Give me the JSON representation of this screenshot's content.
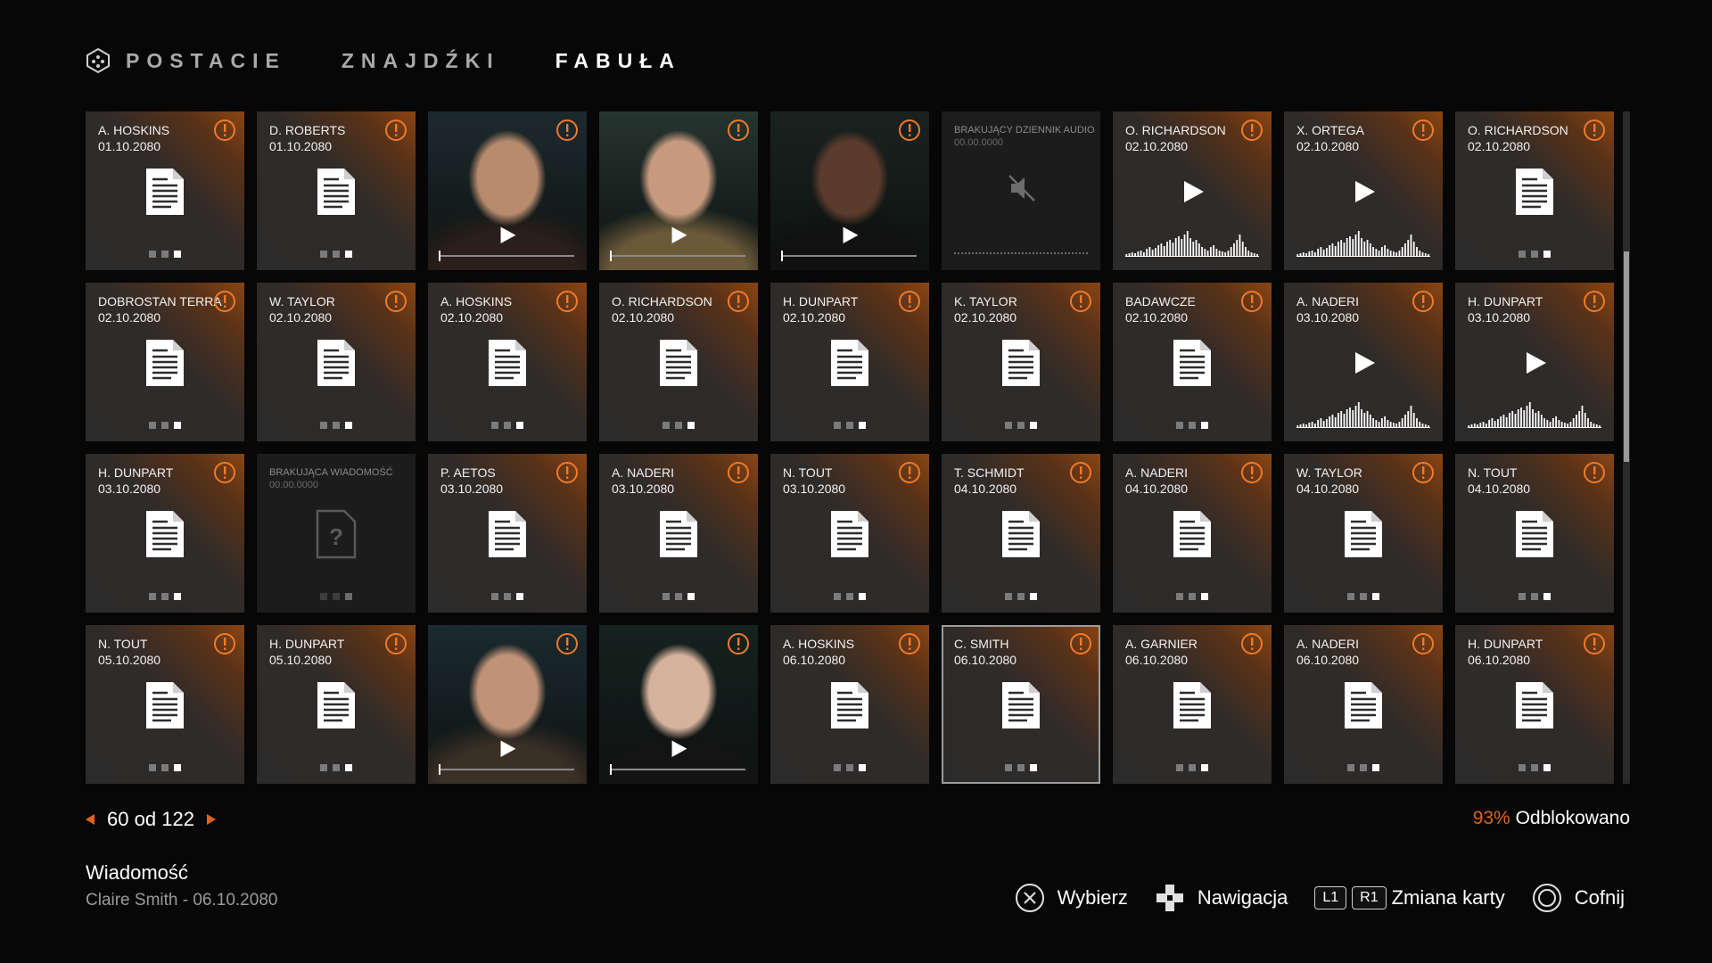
{
  "tabs": [
    {
      "label": "POSTACIE",
      "active": false
    },
    {
      "label": "ZNAJDŹKI",
      "active": false
    },
    {
      "label": "FABUŁA",
      "active": true
    }
  ],
  "cards": [
    {
      "type": "doc",
      "title": "A. HOSKINS",
      "date": "01.10.2080",
      "alert": true
    },
    {
      "type": "doc",
      "title": "D. ROBERTS",
      "date": "01.10.2080",
      "alert": true
    },
    {
      "type": "video",
      "alert": true,
      "scene": "man-beard"
    },
    {
      "type": "video",
      "alert": true,
      "scene": "man-blond"
    },
    {
      "type": "video",
      "alert": true,
      "scene": "man-dark"
    },
    {
      "type": "missing-audio",
      "title": "BRAKUJĄCY DZIENNIK AUDIO",
      "date": "00.00.0000"
    },
    {
      "type": "audio",
      "title": "O. RICHARDSON",
      "date": "02.10.2080",
      "alert": true
    },
    {
      "type": "audio",
      "title": "X. ORTEGA",
      "date": "02.10.2080",
      "alert": true
    },
    {
      "type": "doc",
      "title": "O. RICHARDSON",
      "date": "02.10.2080",
      "alert": true
    },
    {
      "type": "doc",
      "title": "DOBROSTAN TERRA",
      "date": "02.10.2080",
      "alert": true
    },
    {
      "type": "doc",
      "title": "W. TAYLOR",
      "date": "02.10.2080",
      "alert": true
    },
    {
      "type": "doc",
      "title": "A. HOSKINS",
      "date": "02.10.2080",
      "alert": true
    },
    {
      "type": "doc",
      "title": "O. RICHARDSON",
      "date": "02.10.2080",
      "alert": true
    },
    {
      "type": "doc",
      "title": "H. DUNPART",
      "date": "02.10.2080",
      "alert": true
    },
    {
      "type": "doc",
      "title": "K. TAYLOR",
      "date": "02.10.2080",
      "alert": true
    },
    {
      "type": "doc",
      "title": "BADAWCZE",
      "date": "02.10.2080",
      "alert": true
    },
    {
      "type": "audio",
      "title": "A. NADERI",
      "date": "03.10.2080",
      "alert": true
    },
    {
      "type": "audio",
      "title": "H. DUNPART",
      "date": "03.10.2080",
      "alert": true
    },
    {
      "type": "doc",
      "title": "H. DUNPART",
      "date": "03.10.2080",
      "alert": true
    },
    {
      "type": "missing-doc",
      "title": "BRAKUJĄCA WIADOMOŚĆ",
      "date": "00.00.0000"
    },
    {
      "type": "doc",
      "title": "P. AETOS",
      "date": "03.10.2080",
      "alert": true
    },
    {
      "type": "doc",
      "title": "A. NADERI",
      "date": "03.10.2080",
      "alert": true
    },
    {
      "type": "doc",
      "title": "N. TOUT",
      "date": "03.10.2080",
      "alert": true
    },
    {
      "type": "doc",
      "title": "T. SCHMIDT",
      "date": "04.10.2080",
      "alert": true
    },
    {
      "type": "doc",
      "title": "A. NADERI",
      "date": "04.10.2080",
      "alert": true
    },
    {
      "type": "doc",
      "title": "W. TAYLOR",
      "date": "04.10.2080",
      "alert": true
    },
    {
      "type": "doc",
      "title": "N. TOUT",
      "date": "04.10.2080",
      "alert": true
    },
    {
      "type": "doc",
      "title": "N. TOUT",
      "date": "05.10.2080",
      "alert": true
    },
    {
      "type": "doc",
      "title": "H. DUNPART",
      "date": "05.10.2080",
      "alert": true
    },
    {
      "type": "video",
      "alert": true,
      "scene": "man-hand"
    },
    {
      "type": "video",
      "alert": true,
      "scene": "woman"
    },
    {
      "type": "doc",
      "title": "A. HOSKINS",
      "date": "06.10.2080",
      "alert": true
    },
    {
      "type": "doc",
      "title": "C. SMITH",
      "date": "06.10.2080",
      "alert": true,
      "selected": true
    },
    {
      "type": "doc",
      "title": "A. GARNIER",
      "date": "06.10.2080",
      "alert": true
    },
    {
      "type": "doc",
      "title": "A. NADERI",
      "date": "06.10.2080",
      "alert": true
    },
    {
      "type": "doc",
      "title": "H. DUNPART",
      "date": "06.10.2080",
      "alert": true
    }
  ],
  "pager": {
    "current": "60",
    "separator": "od",
    "total": "122"
  },
  "unlocked": {
    "percent": "93%",
    "label": "Odblokowano"
  },
  "info": {
    "title": "Wiadomość",
    "subtitle": "Claire Smith - 06.10.2080"
  },
  "controls": [
    {
      "icon": "cross-button-icon",
      "label": "Wybierz"
    },
    {
      "icon": "dpad-icon",
      "label": "Nawigacja"
    },
    {
      "icon": "shoulder-buttons",
      "keys": [
        "L1",
        "R1"
      ],
      "label": "Zmiana karty"
    },
    {
      "icon": "circle-button-icon",
      "label": "Cofnij"
    }
  ],
  "colors": {
    "accent": "#e0631d",
    "alert_gradient": "#8a4512",
    "card": "#2d2d2d",
    "background": "#070707"
  }
}
